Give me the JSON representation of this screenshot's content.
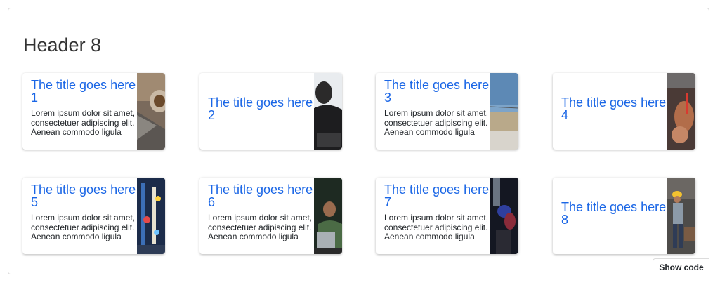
{
  "header": {
    "title": "Header 8"
  },
  "cards": [
    {
      "title": "The title goes here 1",
      "text": "Lorem ipsum dolor sit amet, consectetuer adipiscing elit. Aenean commodo ligula eget…",
      "image": "photo-laptop-coffee"
    },
    {
      "title": "The title goes here 2",
      "text": "",
      "image": "photo-person-back"
    },
    {
      "title": "The title goes here 3",
      "text": "Lorem ipsum dolor sit amet, consectetuer adipiscing elit. Aenean commodo ligula eget…",
      "image": "photo-sky-building"
    },
    {
      "title": "The title goes here 4",
      "text": "",
      "image": "photo-hands-tools"
    },
    {
      "title": "The title goes here 5",
      "text": "Lorem ipsum dolor sit amet, consectetuer adipiscing elit. Aenean commodo ligula eget…",
      "image": "photo-city-lights"
    },
    {
      "title": "The title goes here 6",
      "text": "Lorem ipsum dolor sit amet, consectetuer adipiscing elit. Aenean commodo ligula eget…",
      "image": "photo-man-laptop"
    },
    {
      "title": "The title goes here 7",
      "text": "Lorem ipsum dolor sit amet, consectetuer adipiscing elit. Aenean commodo ligula eget…",
      "image": "photo-crowd-night"
    },
    {
      "title": "The title goes here 8",
      "text": "",
      "image": "photo-worker-helmet"
    }
  ],
  "show_code": {
    "label": "Show code"
  },
  "colors": {
    "title": "#1a66e6",
    "text": "#212529",
    "header": "#333333"
  }
}
